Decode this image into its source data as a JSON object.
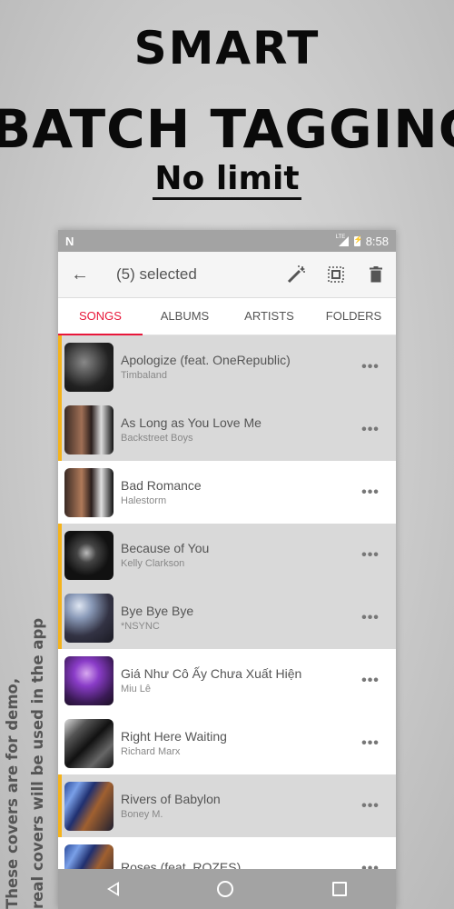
{
  "promo": {
    "line1": "SMART",
    "line2": "BATCH TAGGING",
    "line3": "No limit",
    "side_note_line1": "These covers are for demo,",
    "side_note_line2": "real covers will be used in the app"
  },
  "status_bar": {
    "notification_icon": "N",
    "network": "LTE",
    "time": "8:58"
  },
  "toolbar": {
    "back_icon": "←",
    "title": "(5) selected",
    "actions": [
      "magic-wand-icon",
      "select-all-icon",
      "delete-icon"
    ]
  },
  "tabs": [
    {
      "label": "SONGS",
      "active": true
    },
    {
      "label": "ALBUMS",
      "active": false
    },
    {
      "label": "ARTISTS",
      "active": false
    },
    {
      "label": "FOLDERS",
      "active": false
    }
  ],
  "accent_color": "#e8173a",
  "selection_color": "#f5b31b",
  "songs": [
    {
      "title": "Apologize (feat. OneRepublic)",
      "artist": "Timbaland",
      "selected": true
    },
    {
      "title": "As Long as You Love Me",
      "artist": "Backstreet Boys",
      "selected": true
    },
    {
      "title": "Bad Romance",
      "artist": "Halestorm",
      "selected": false
    },
    {
      "title": "Because of You",
      "artist": "Kelly Clarkson",
      "selected": true
    },
    {
      "title": "Bye Bye Bye",
      "artist": "*NSYNC",
      "selected": true
    },
    {
      "title": "Giá Như Cô Ấy Chưa Xuất Hiện",
      "artist": "Miu Lê",
      "selected": false
    },
    {
      "title": "Right Here Waiting",
      "artist": "Richard Marx",
      "selected": false
    },
    {
      "title": "Rivers of Babylon",
      "artist": "Boney M.",
      "selected": true
    },
    {
      "title": "Roses (feat. ROZES)",
      "artist": "",
      "selected": false
    }
  ],
  "more_icon": "•••"
}
